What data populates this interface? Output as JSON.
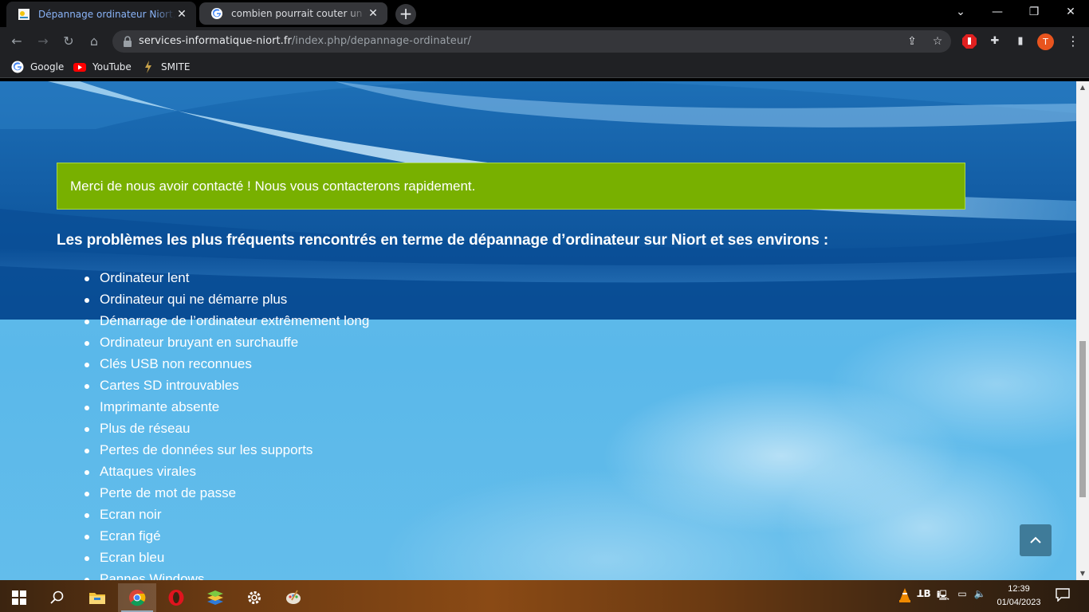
{
  "browser": {
    "tabs": [
      {
        "title": "Dépannage ordinateur Niort, informatique",
        "active": true
      },
      {
        "title": "combien pourrait couter un - Recherche Google",
        "active": false
      }
    ],
    "new_tab_label": "+",
    "url_host": "services-informatique-niort.fr",
    "url_path": "/index.php/depannage-ordinateur/",
    "profile_initial": "T",
    "bookmarks": [
      {
        "label": "Google",
        "icon": "google-icon"
      },
      {
        "label": "YouTube",
        "icon": "youtube-icon"
      },
      {
        "label": "SMITE",
        "icon": "smite-icon"
      }
    ]
  },
  "page": {
    "notice": "Merci de nous avoir contacté ! Nous vous contacterons rapidement.",
    "section_title": "Les problèmes les plus fréquents rencontrés en terme de dépannage d’ordinateur sur Niort et ses environs :",
    "problems": [
      "Ordinateur lent",
      "Ordinateur qui ne démarre plus",
      "Démarrage de l’ordinateur extrêmement long",
      "Ordinateur bruyant en surchauffe",
      "Clés USB non reconnues",
      "Cartes SD introuvables",
      "Imprimante absente",
      "Plus de réseau",
      "Pertes de données sur les supports",
      "Attaques virales",
      "Perte de mot de passe",
      "Ecran noir",
      "Ecran figé",
      "Ecran bleu",
      "Pannes Windows"
    ]
  },
  "taskbar": {
    "time": "12:39",
    "date": "01/04/2023",
    "apps": [
      "start-icon",
      "search-icon",
      "file-explorer-icon",
      "chrome-icon",
      "opera-icon",
      "bluestacks-icon",
      "settings-icon",
      "paint-icon"
    ]
  },
  "colors": {
    "notice_bg": "#78b000",
    "hero_blue": "#0c5299",
    "sky_blue": "#5ab8ea",
    "tab_active_text": "#8ab4f8"
  }
}
